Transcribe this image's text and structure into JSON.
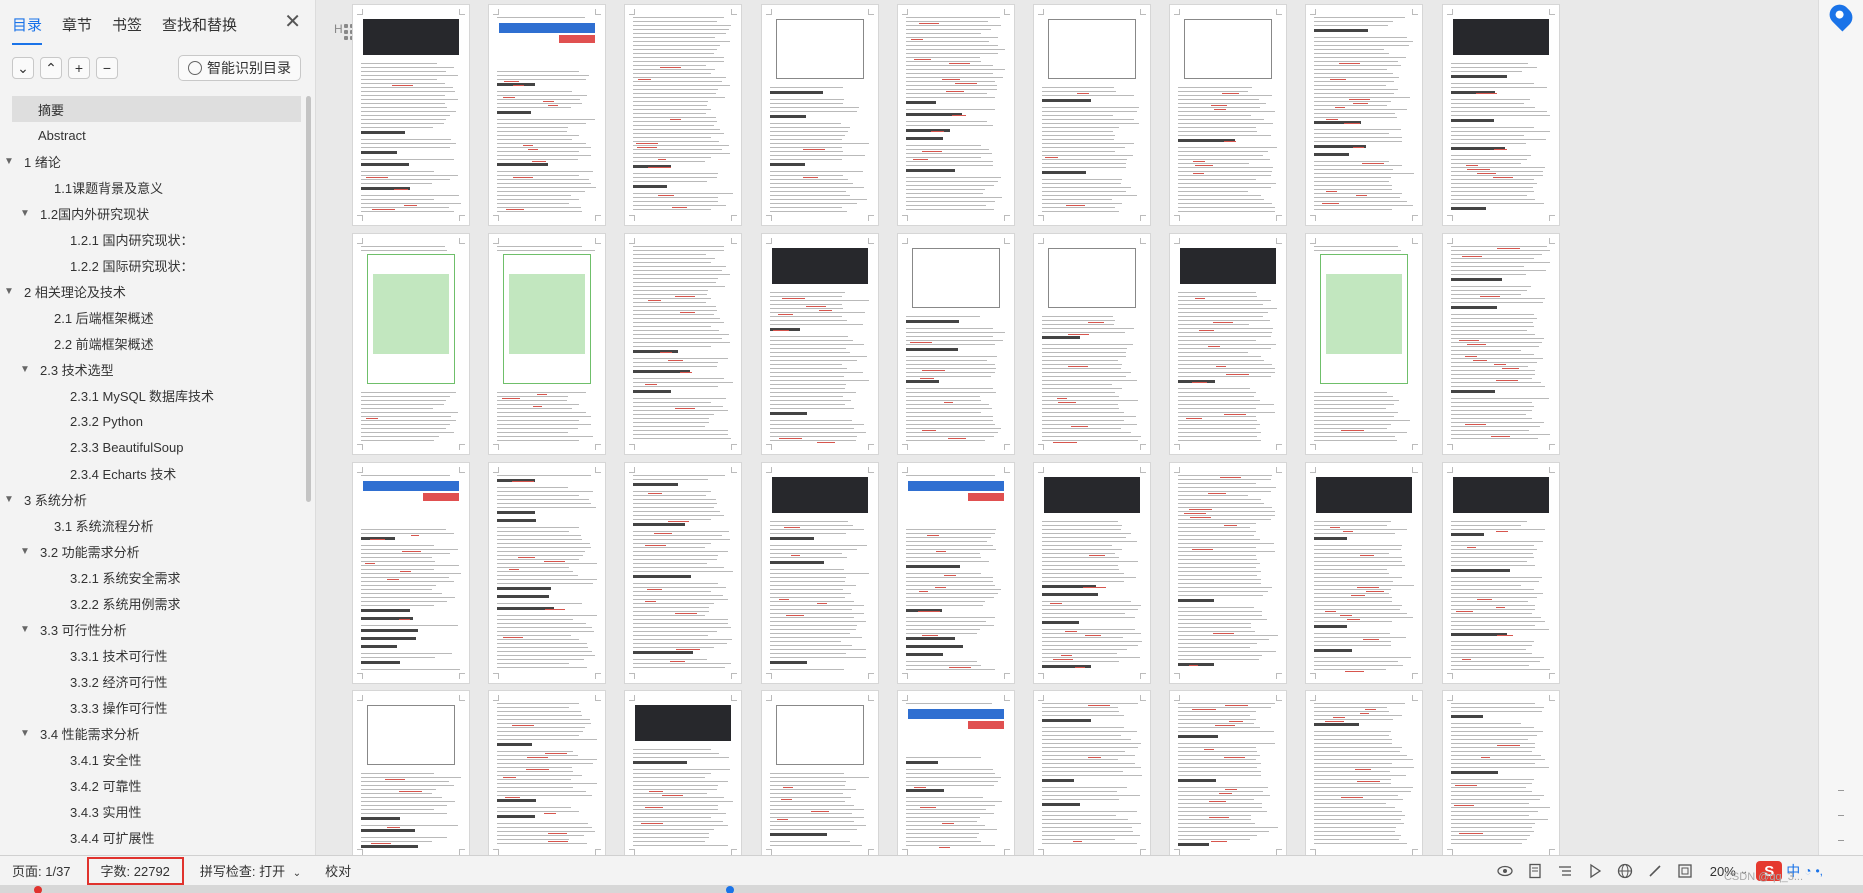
{
  "sidebar": {
    "tabs": [
      "目录",
      "章节",
      "书签",
      "查找和替换"
    ],
    "smart_button": "智能识别目录",
    "toc": [
      {
        "label": "摘要",
        "level": 0,
        "arrow": false,
        "selected": true
      },
      {
        "label": "Abstract",
        "level": 0,
        "arrow": false
      },
      {
        "label": "1  绪论",
        "level": 0,
        "arrow": true
      },
      {
        "label": "1.1课题背景及意义",
        "level": 1,
        "arrow": false
      },
      {
        "label": "1.2国内外研究现状",
        "level": 1,
        "arrow": true
      },
      {
        "label": "1.2.1  国内研究现状：",
        "level": 2,
        "arrow": false
      },
      {
        "label": "1.2.2  国际研究现状：",
        "level": 2,
        "arrow": false
      },
      {
        "label": "2  相关理论及技术",
        "level": 0,
        "arrow": true
      },
      {
        "label": "2.1  后端框架概述",
        "level": 1,
        "arrow": false
      },
      {
        "label": "2.2  前端框架概述",
        "level": 1,
        "arrow": false
      },
      {
        "label": "2.3  技术选型",
        "level": 1,
        "arrow": true
      },
      {
        "label": "2.3.1 MySQL  数据库技术",
        "level": 2,
        "arrow": false
      },
      {
        "label": "2.3.2 Python",
        "level": 2,
        "arrow": false
      },
      {
        "label": "2.3.3 BeautifulSoup",
        "level": 2,
        "arrow": false
      },
      {
        "label": "2.3.4 Echarts  技术",
        "level": 2,
        "arrow": false
      },
      {
        "label": "3  系统分析",
        "level": 0,
        "arrow": true
      },
      {
        "label": "3.1 系统流程分析",
        "level": 1,
        "arrow": false
      },
      {
        "label": "3.2 功能需求分析",
        "level": 1,
        "arrow": true
      },
      {
        "label": "3.2.1  系统安全需求",
        "level": 2,
        "arrow": false
      },
      {
        "label": "3.2.2  系统用例需求",
        "level": 2,
        "arrow": false
      },
      {
        "label": "3.3  可行性分析",
        "level": 1,
        "arrow": true
      },
      {
        "label": "3.3.1  技术可行性",
        "level": 2,
        "arrow": false
      },
      {
        "label": "3.3.2  经济可行性",
        "level": 2,
        "arrow": false
      },
      {
        "label": "3.3.3  操作可行性",
        "level": 2,
        "arrow": false
      },
      {
        "label": "3.4  性能需求分析",
        "level": 1,
        "arrow": true
      },
      {
        "label": "3.4.1  安全性",
        "level": 2,
        "arrow": false
      },
      {
        "label": "3.4.2  可靠性",
        "level": 2,
        "arrow": false
      },
      {
        "label": "3.4.3  实用性",
        "level": 2,
        "arrow": false
      },
      {
        "label": "3.4.4  可扩展性",
        "level": 2,
        "arrow": false
      }
    ]
  },
  "status": {
    "page": "页面: 1/37",
    "word_count": "字数: 22792",
    "spell_check": "拼写检查: 打开",
    "proof": "校对",
    "zoom": "20%",
    "ime": "中",
    "watermark": "CSDN @qq_3..."
  },
  "pages": {
    "rows": 4,
    "cols": 9
  }
}
